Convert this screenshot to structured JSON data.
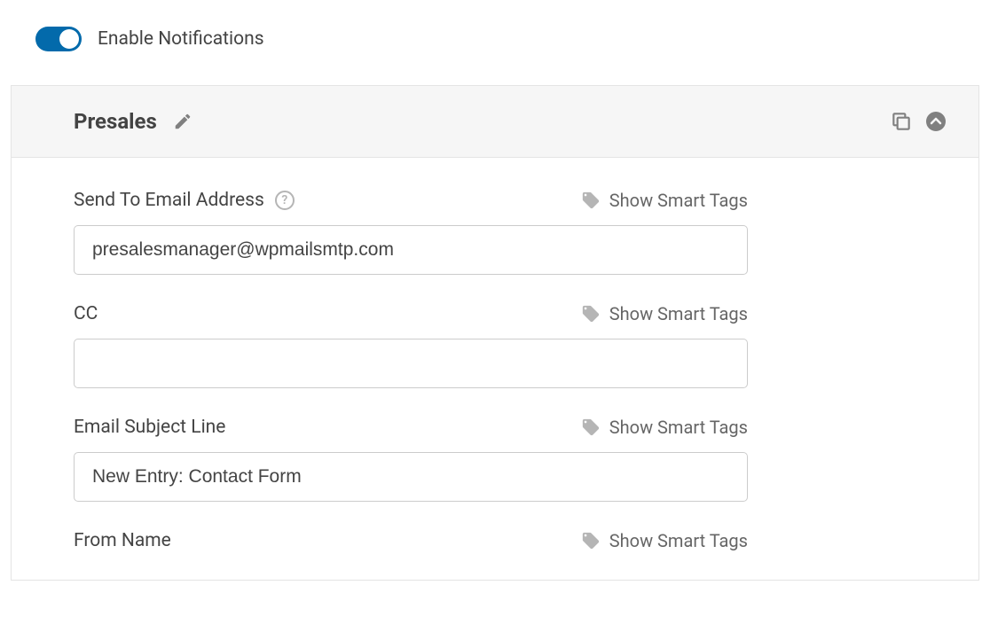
{
  "toggle": {
    "label": "Enable Notifications",
    "state": true
  },
  "panel": {
    "title": "Presales"
  },
  "fields": {
    "send_to": {
      "label": "Send To Email Address",
      "value": "presalesmanager@wpmailsmtp.com",
      "smart_tags": "Show Smart Tags"
    },
    "cc": {
      "label": "CC",
      "value": "",
      "smart_tags": "Show Smart Tags"
    },
    "subject": {
      "label": "Email Subject Line",
      "value": "New Entry: Contact Form",
      "smart_tags": "Show Smart Tags"
    },
    "from_name": {
      "label": "From Name",
      "smart_tags": "Show Smart Tags"
    }
  }
}
